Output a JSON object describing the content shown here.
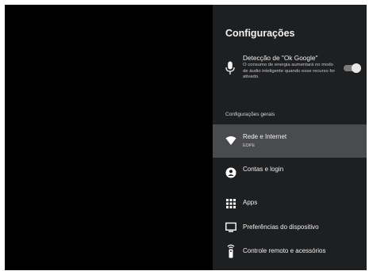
{
  "settings": {
    "title": "Configurações",
    "ok_google": {
      "title": "Detecção de \"Ok Google\"",
      "description": "O consumo de energia aumentará no modo de áudio inteligente quando esse recurso for ativado.",
      "toggle_on": true
    },
    "section_label": "Configurações gerais",
    "items": [
      {
        "label": "Rede e Internet",
        "sublabel": "EDPE",
        "icon": "wifi-icon",
        "selected": true
      },
      {
        "label": "Contas e login",
        "icon": "account-icon"
      },
      {
        "label": "Apps",
        "icon": "apps-grid-icon"
      },
      {
        "label": "Preferências do dispositivo",
        "icon": "tv-icon"
      },
      {
        "label": "Controle remoto e acessórios",
        "icon": "remote-icon"
      }
    ]
  },
  "colors": {
    "panel_bg": "#1e1f21",
    "selected_bg": "#4a4b4e",
    "screen_bg": "#000000"
  }
}
